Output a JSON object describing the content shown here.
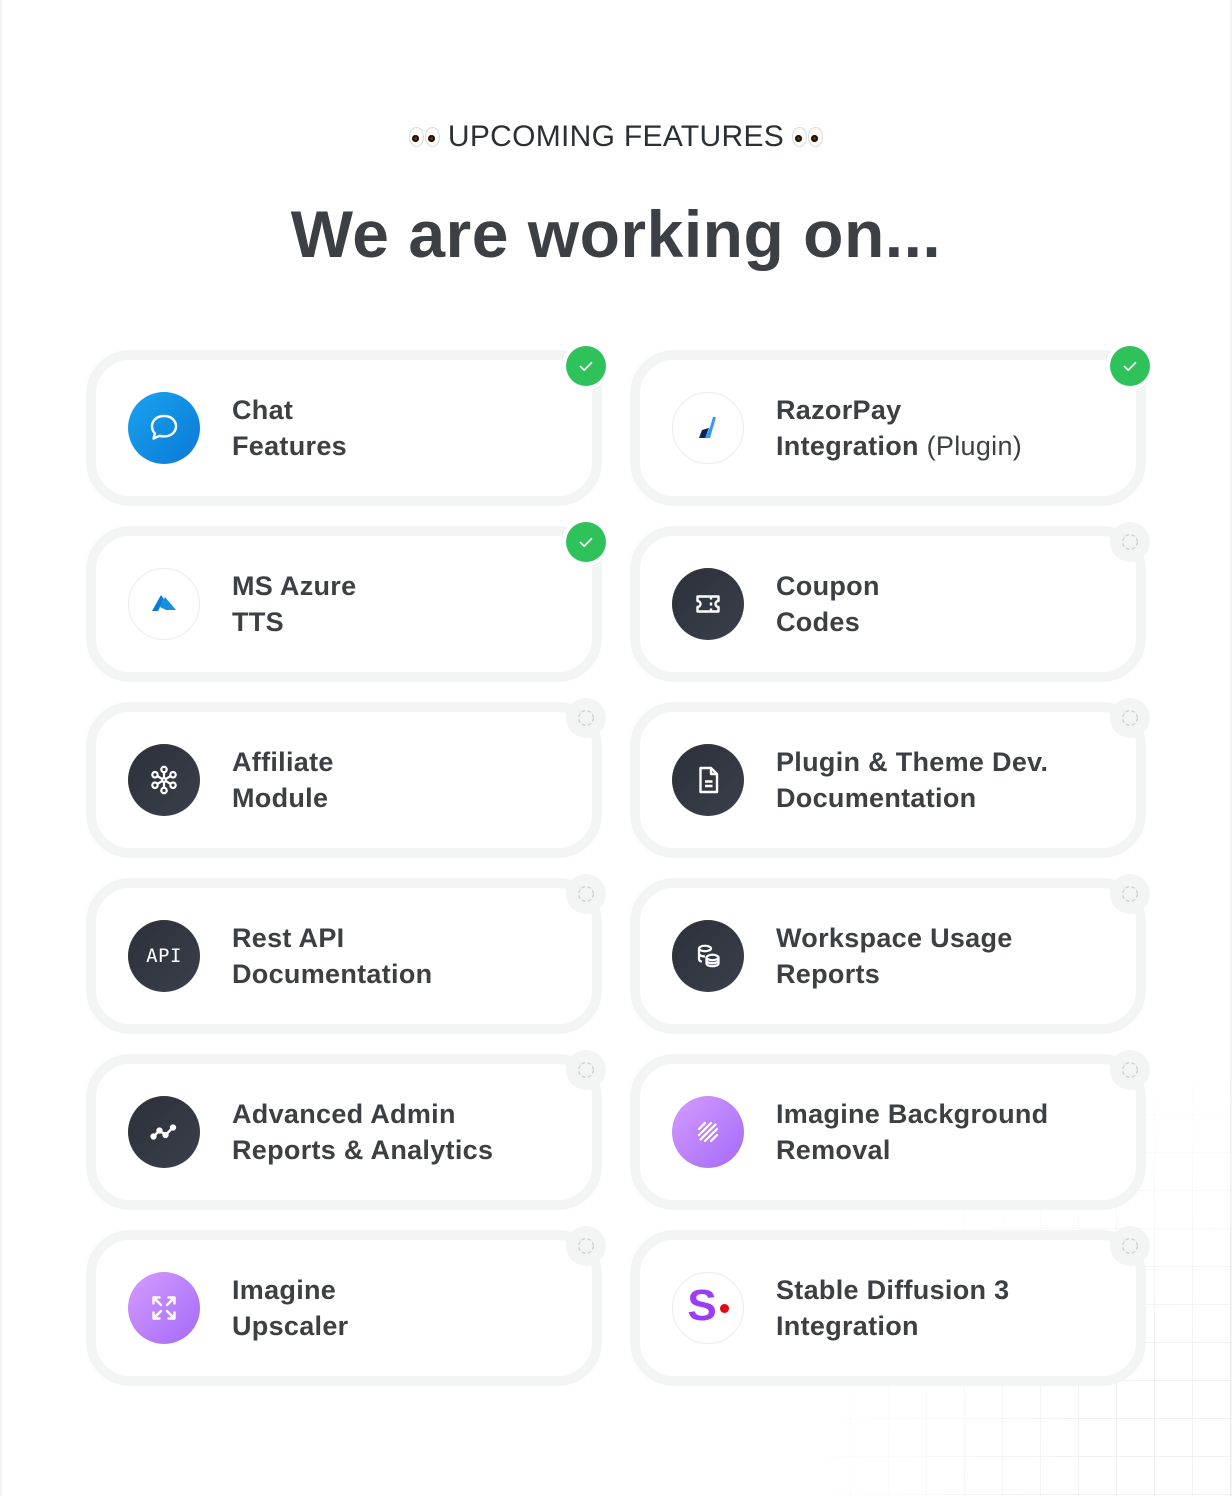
{
  "header": {
    "eyebrow_icon": "eyes-emoji",
    "eyebrow": "UPCOMING FEATURES",
    "headline": "We are working on..."
  },
  "colors": {
    "done": "#2fc25b",
    "pending": "#f3f4f4",
    "text": "#3c3f44",
    "chat_blue": "#0a79d6",
    "dark_icon": "#2b303a",
    "purple_icon": "#a56af7",
    "stable_diffusion_purple": "#9b3df0",
    "stable_diffusion_red": "#e5060f"
  },
  "features": [
    {
      "line1": "Chat",
      "line2": "Features",
      "suffix": "",
      "icon": "chat-bubble-icon",
      "status": "done"
    },
    {
      "line1": "RazorPay",
      "line2": "Integration",
      "suffix": "(Plugin)",
      "icon": "razorpay-logo-icon",
      "status": "done"
    },
    {
      "line1": "MS Azure",
      "line2": "TTS",
      "suffix": "",
      "icon": "azure-logo-icon",
      "status": "done"
    },
    {
      "line1": "Coupon",
      "line2": "Codes",
      "suffix": "",
      "icon": "ticket-icon",
      "status": "pending"
    },
    {
      "line1": "Affiliate",
      "line2": "Module",
      "suffix": "",
      "icon": "network-icon",
      "status": "pending"
    },
    {
      "line1": "Plugin & Theme Dev.",
      "line2": "Documentation",
      "suffix": "",
      "icon": "document-icon",
      "status": "pending"
    },
    {
      "line1": "Rest API",
      "line2": "Documentation",
      "suffix": "",
      "icon": "api-icon",
      "icon_text": "API",
      "status": "pending"
    },
    {
      "line1": "Workspace Usage",
      "line2": "Reports",
      "suffix": "",
      "icon": "coins-icon",
      "status": "pending"
    },
    {
      "line1": "Advanced Admin",
      "line2": "Reports & Analytics",
      "suffix": "",
      "icon": "line-chart-icon",
      "status": "pending"
    },
    {
      "line1": "Imagine Background",
      "line2": "Removal",
      "suffix": "",
      "icon": "stripes-icon",
      "status": "pending"
    },
    {
      "line1": "Imagine",
      "line2": "Upscaler",
      "suffix": "",
      "icon": "expand-arrows-icon",
      "status": "pending"
    },
    {
      "line1": "Stable Diffusion 3",
      "line2": "Integration",
      "suffix": "",
      "icon": "stable-diffusion-logo-icon",
      "icon_text": "S",
      "status": "pending"
    }
  ]
}
